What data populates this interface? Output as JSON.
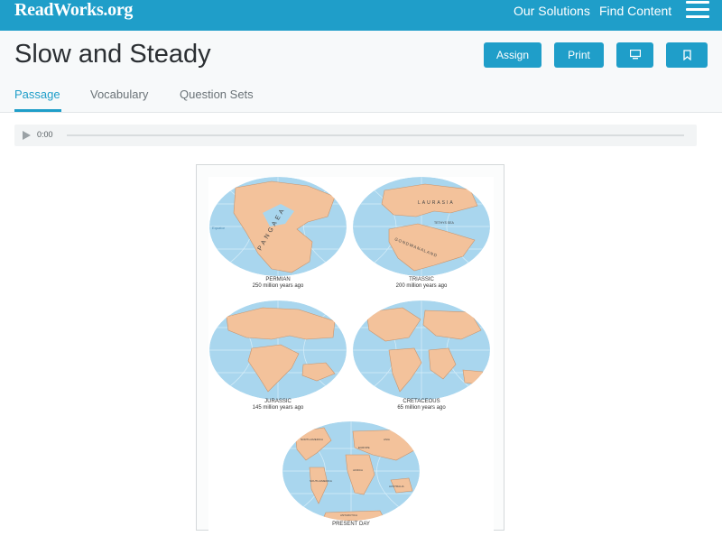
{
  "header": {
    "logo": "ReadWorks.org",
    "nav": [
      "Our Solutions",
      "Find Content"
    ]
  },
  "page": {
    "title": "Slow and Steady",
    "buttons": {
      "assign": "Assign",
      "print": "Print"
    },
    "tabs": [
      "Passage",
      "Vocabulary",
      "Question Sets"
    ],
    "active_tab": "Passage"
  },
  "audio": {
    "time": "0:00"
  },
  "figure": {
    "maps": [
      {
        "label": "PERMIAN",
        "sub": "250 million years ago",
        "words": [
          "PANGAEA"
        ]
      },
      {
        "label": "TRIASSIC",
        "sub": "200 million years ago",
        "words": [
          "LAURASIA",
          "TETHYS SEA",
          "GONDWANALAND"
        ]
      },
      {
        "label": "JURASSIC",
        "sub": "145 million years ago",
        "words": []
      },
      {
        "label": "CRETACEOUS",
        "sub": "65 million years ago",
        "words": []
      },
      {
        "label": "PRESENT DAY",
        "sub": "",
        "words": [
          "NORTH AMERICA",
          "ASIA",
          "EUROPE",
          "AFRICA",
          "SOUTH AMERICA",
          "AUSTRALIA",
          "ANTARCTICA"
        ]
      }
    ],
    "equator": "Equator"
  },
  "colors": {
    "accent": "#1f9ec9",
    "ocean": "#a9d6ee",
    "land": "#f3c29b"
  }
}
